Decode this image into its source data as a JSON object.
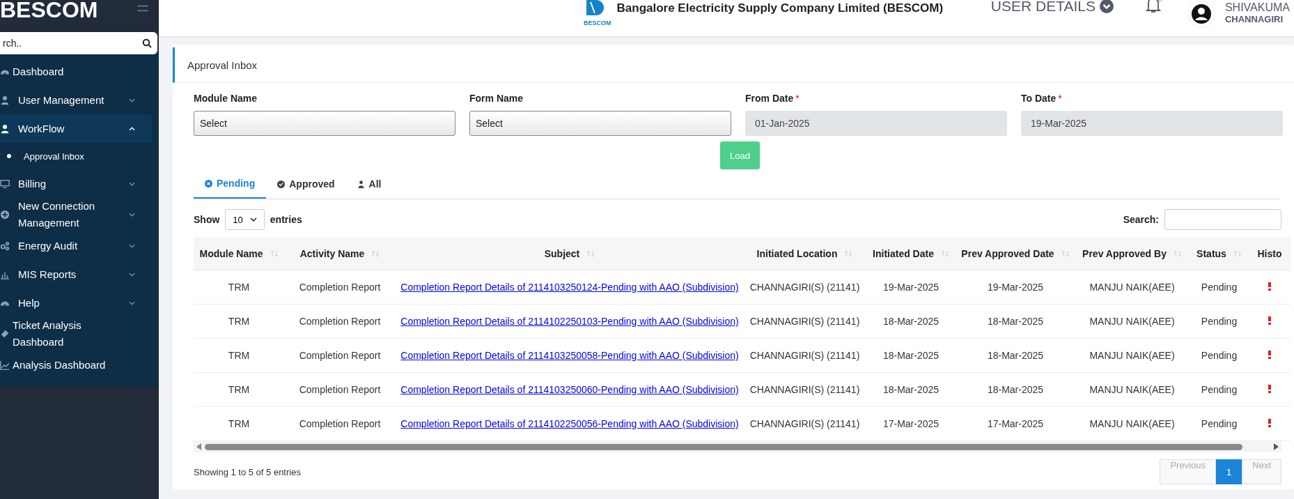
{
  "brand": "BESCOM",
  "sidebar": {
    "search": {
      "placeholder": "rch.."
    },
    "items": [
      {
        "label": "Dashboard",
        "kind": "gauge",
        "expandable": false,
        "selected": false
      },
      {
        "label": "User Management",
        "kind": "user",
        "expandable": true,
        "expanded": false,
        "selected": false
      },
      {
        "label": "WorkFlow",
        "kind": "user",
        "expandable": true,
        "expanded": true,
        "selected": true,
        "children": [
          {
            "label": "Approval Inbox"
          }
        ]
      },
      {
        "label": "Billing",
        "kind": "monitor",
        "expandable": true,
        "expanded": false,
        "selected": false
      },
      {
        "label": "New Connection Management",
        "kind": "plus",
        "expandable": true,
        "expanded": false,
        "selected": false
      },
      {
        "label": "Energy Audit",
        "kind": "gears",
        "expandable": true,
        "expanded": false,
        "selected": false
      },
      {
        "label": "MIS Reports",
        "kind": "bars",
        "expandable": true,
        "expanded": false,
        "selected": false
      },
      {
        "label": "Help",
        "kind": "gauge",
        "expandable": true,
        "expanded": false,
        "selected": false
      },
      {
        "label": "Ticket Analysis Dashboard",
        "kind": "ticket",
        "expandable": false,
        "selected": false
      },
      {
        "label": "Analysis Dashboard",
        "kind": "line",
        "expandable": false,
        "selected": false
      }
    ]
  },
  "header": {
    "logo_text": "BESCOM",
    "title": "Bangalore Electricity Supply Company Limited (BESCOM)",
    "user_details": "USER DETAILS",
    "user_name": "SHIVAKUMA",
    "user_location": "CHANNAGIRI"
  },
  "page_title": "Approval Inbox",
  "filters": [
    {
      "label": "Module Name",
      "kind": "select",
      "value": "Select"
    },
    {
      "label": "Form Name",
      "kind": "select",
      "value": "Select"
    },
    {
      "label": "From Date",
      "required_mark": "*",
      "kind": "date",
      "value": "01-Jan-2025"
    },
    {
      "label": "To Date",
      "required_mark": "*",
      "kind": "date",
      "value": "19-Mar-2025"
    }
  ],
  "load_button": "Load",
  "tabs": [
    {
      "label": "Pending",
      "kind": "pending",
      "selected": true
    },
    {
      "label": "Approved",
      "kind": "approved",
      "selected": false
    },
    {
      "label": "All",
      "kind": "all",
      "selected": false
    }
  ],
  "length": {
    "before": "Show",
    "value": "10",
    "after": "entries"
  },
  "search_label": "Search:",
  "table": {
    "columns": [
      {
        "label": "Module Name",
        "sortable": true
      },
      {
        "label": "Activity Name",
        "sortable": true
      },
      {
        "label": "Subject",
        "sortable": true
      },
      {
        "label": "Initiated Location",
        "sortable": true
      },
      {
        "label": "Initiated Date",
        "sortable": true
      },
      {
        "label": "Prev Approved Date",
        "sortable": true
      },
      {
        "label": "Prev Approved By",
        "sortable": true
      },
      {
        "label": "Status",
        "sortable": true
      },
      {
        "label": "Histo",
        "sortable": false
      }
    ],
    "rows": [
      [
        "TRM",
        "Completion Report",
        "Completion Report Details of 2114103250124-Pending with AAO (Subdivision)",
        "CHANNAGIRI(S) (21141)",
        "19-Mar-2025",
        "19-Mar-2025",
        "MANJU NAIK(AEE)",
        "Pending"
      ],
      [
        "TRM",
        "Completion Report",
        "Completion Report Details of 2114102250103-Pending with AAO (Subdivision)",
        "CHANNAGIRI(S) (21141)",
        "18-Mar-2025",
        "18-Mar-2025",
        "MANJU NAIK(AEE)",
        "Pending"
      ],
      [
        "TRM",
        "Completion Report",
        "Completion Report Details of 2114103250058-Pending with AAO (Subdivision)",
        "CHANNAGIRI(S) (21141)",
        "18-Mar-2025",
        "18-Mar-2025",
        "MANJU NAIK(AEE)",
        "Pending"
      ],
      [
        "TRM",
        "Completion Report",
        "Completion Report Details of 2114103250060-Pending with AAO (Subdivision)",
        "CHANNAGIRI(S) (21141)",
        "18-Mar-2025",
        "18-Mar-2025",
        "MANJU NAIK(AEE)",
        "Pending"
      ],
      [
        "TRM",
        "Completion Report",
        "Completion Report Details of 2114102250056-Pending with AAO (Subdivision)",
        "CHANNAGIRI(S) (21141)",
        "17-Mar-2025",
        "17-Mar-2025",
        "MANJU NAIK(AEE)",
        "Pending"
      ]
    ]
  },
  "info": "Showing 1 to 5 of 5 entries",
  "pagination": [
    {
      "label": "Previous",
      "kind": "nav",
      "disabled": true,
      "selected": false
    },
    {
      "label": "1",
      "kind": "page",
      "disabled": false,
      "selected": true
    },
    {
      "label": "Next",
      "kind": "nav",
      "disabled": true,
      "selected": false
    }
  ]
}
